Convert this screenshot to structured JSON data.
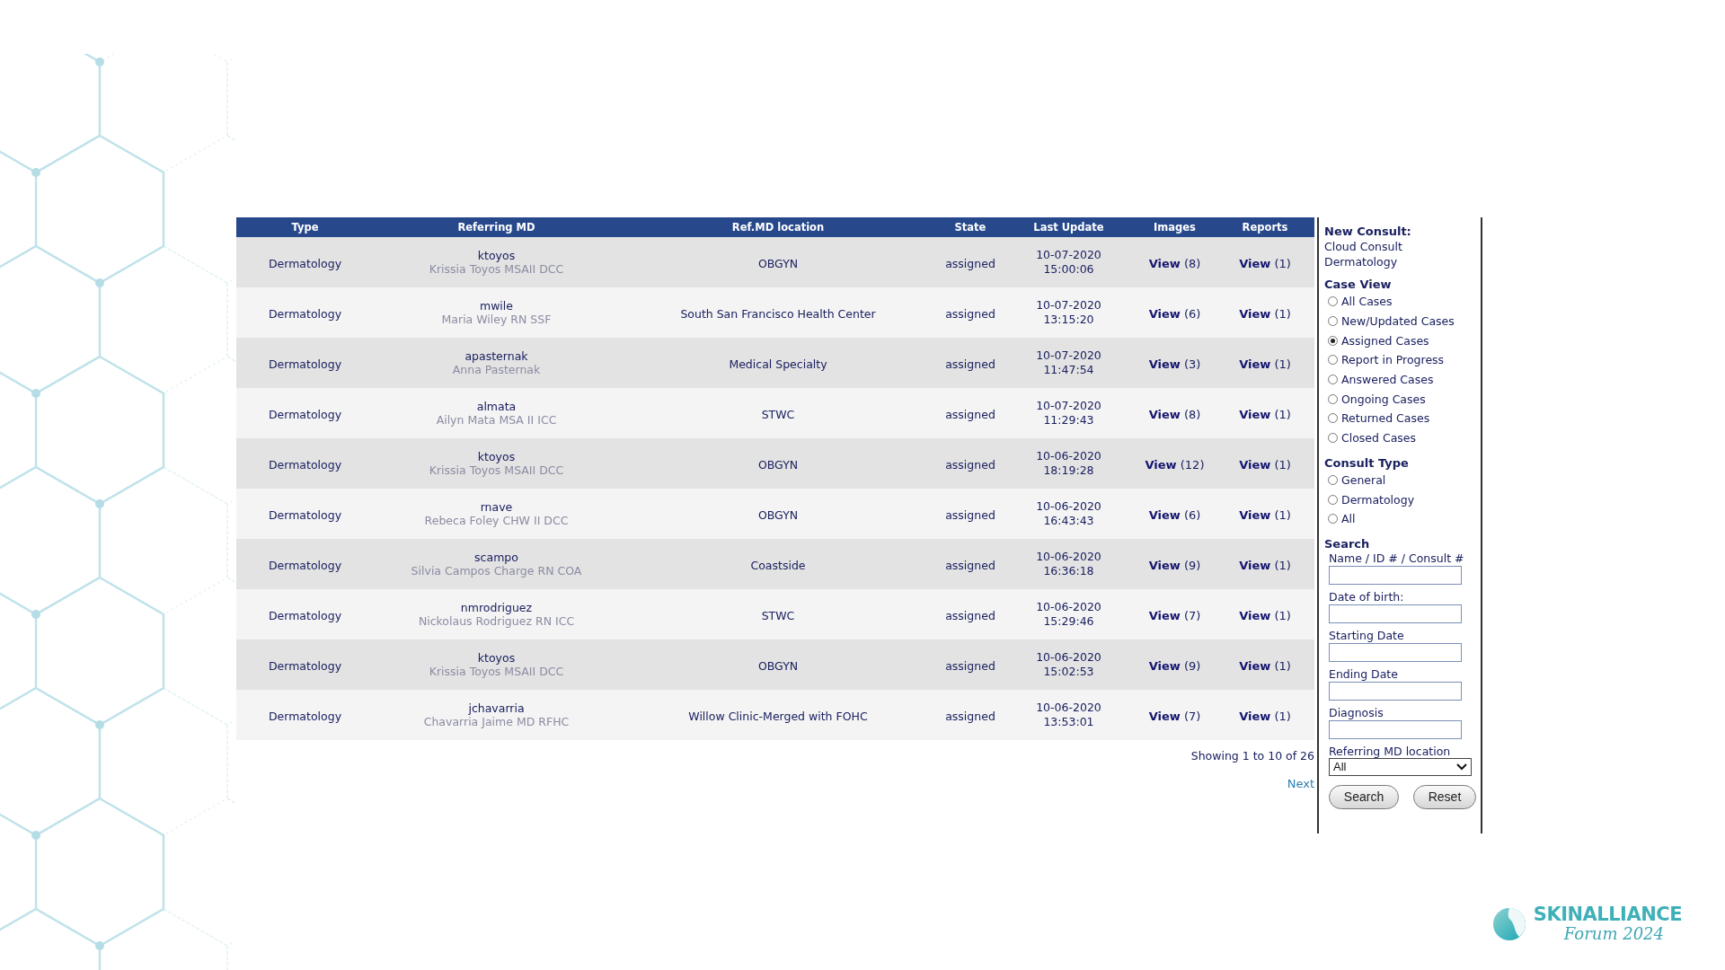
{
  "table": {
    "columns": [
      "Type",
      "Referring MD",
      "Ref.MD location",
      "State",
      "Last Update",
      "Images",
      "Reports"
    ],
    "rows": [
      {
        "type": "Dermatology",
        "username": "ktoyos",
        "full_name": "Krissia Toyos MSAII DCC",
        "location": "OBGYN",
        "state": "assigned",
        "date": "10-07-2020",
        "time": "15:00:06",
        "images": "**View** (8)",
        "reports": "**View** (1)"
      },
      {
        "type": "Dermatology",
        "username": "mwile",
        "full_name": "Maria Wiley RN SSF",
        "location": "South San Francisco Health Center",
        "state": "assigned",
        "date": "10-07-2020",
        "time": "13:15:20",
        "images": "**View** (6)",
        "reports": "**View** (1)"
      },
      {
        "type": "Dermatology",
        "username": "apasternak",
        "full_name": "Anna Pasternak",
        "location": "Medical Specialty",
        "state": "assigned",
        "date": "10-07-2020",
        "time": "11:47:54",
        "images": "**View** (3)",
        "reports": "**View** (1)"
      },
      {
        "type": "Dermatology",
        "username": "almata",
        "full_name": "Ailyn Mata MSA II ICC",
        "location": "STWC",
        "state": "assigned",
        "date": "10-07-2020",
        "time": "11:29:43",
        "images": "**View** (8)",
        "reports": "**View** (1)"
      },
      {
        "type": "Dermatology",
        "username": "ktoyos",
        "full_name": "Krissia Toyos MSAII DCC",
        "location": "OBGYN",
        "state": "assigned",
        "date": "10-06-2020",
        "time": "18:19:28",
        "images": "**View** (12)",
        "reports": "**View** (1)"
      },
      {
        "type": "Dermatology",
        "username": "rnave",
        "full_name": "Rebeca Foley CHW II DCC",
        "location": "OBGYN",
        "state": "assigned",
        "date": "10-06-2020",
        "time": "16:43:43",
        "images": "**View** (6)",
        "reports": "**View** (1)"
      },
      {
        "type": "Dermatology",
        "username": "scampo",
        "full_name": "Silvia Campos Charge RN COA",
        "location": "Coastside",
        "state": "assigned",
        "date": "10-06-2020",
        "time": "16:36:18",
        "images": "**View** (9)",
        "reports": "**View** (1)"
      },
      {
        "type": "Dermatology",
        "username": "nmrodriguez",
        "full_name": "Nickolaus Rodriguez RN ICC",
        "location": "STWC",
        "state": "assigned",
        "date": "10-06-2020",
        "time": "15:29:46",
        "images": "**View** (7)",
        "reports": "**View** (1)"
      },
      {
        "type": "Dermatology",
        "username": "ktoyos",
        "full_name": "Krissia Toyos MSAII DCC",
        "location": "OBGYN",
        "state": "assigned",
        "date": "10-06-2020",
        "time": "15:02:53",
        "images": "**View** (9)",
        "reports": "**View** (1)"
      },
      {
        "type": "Dermatology",
        "username": "jchavarria",
        "full_name": "Chavarria Jaime MD RFHC",
        "location": "Willow Clinic-Merged with FOHC",
        "state": "assigned",
        "date": "10-06-2020",
        "time": "13:53:01",
        "images": "**View** (7)",
        "reports": "**View** (1)"
      }
    ]
  },
  "pagination": {
    "summary": "Showing 1 to 10 of 26",
    "next": "Next"
  },
  "sidebar": {
    "new_consult": {
      "heading": "New Consult:",
      "links": [
        "Cloud Consult",
        "Dermatology"
      ]
    },
    "case_view": {
      "heading": "Case View",
      "options": [
        {
          "label": "All Cases",
          "selected": false
        },
        {
          "label": "New/Updated Cases",
          "selected": false
        },
        {
          "label": "Assigned Cases",
          "selected": true
        },
        {
          "label": "Report in Progress",
          "selected": false
        },
        {
          "label": "Answered Cases",
          "selected": false
        },
        {
          "label": "Ongoing Cases",
          "selected": false
        },
        {
          "label": "Returned Cases",
          "selected": false
        },
        {
          "label": "Closed Cases",
          "selected": false
        }
      ]
    },
    "consult_type": {
      "heading": "Consult Type",
      "options": [
        {
          "label": "General",
          "selected": false
        },
        {
          "label": "Dermatology",
          "selected": false
        },
        {
          "label": "All",
          "selected": false
        }
      ]
    },
    "search": {
      "heading": "Search",
      "fields": [
        {
          "label": "Name / ID # / Consult #"
        },
        {
          "label": "Date of birth:"
        },
        {
          "label": "Starting Date"
        },
        {
          "label": "Ending Date"
        },
        {
          "label": "Diagnosis"
        }
      ],
      "select": {
        "label": "Referring MD location",
        "value": "All"
      },
      "buttons": [
        "Search",
        "Reset"
      ]
    }
  },
  "logo": {
    "name": "SKINALLIANCE",
    "subtitle": "Forum 2024"
  }
}
